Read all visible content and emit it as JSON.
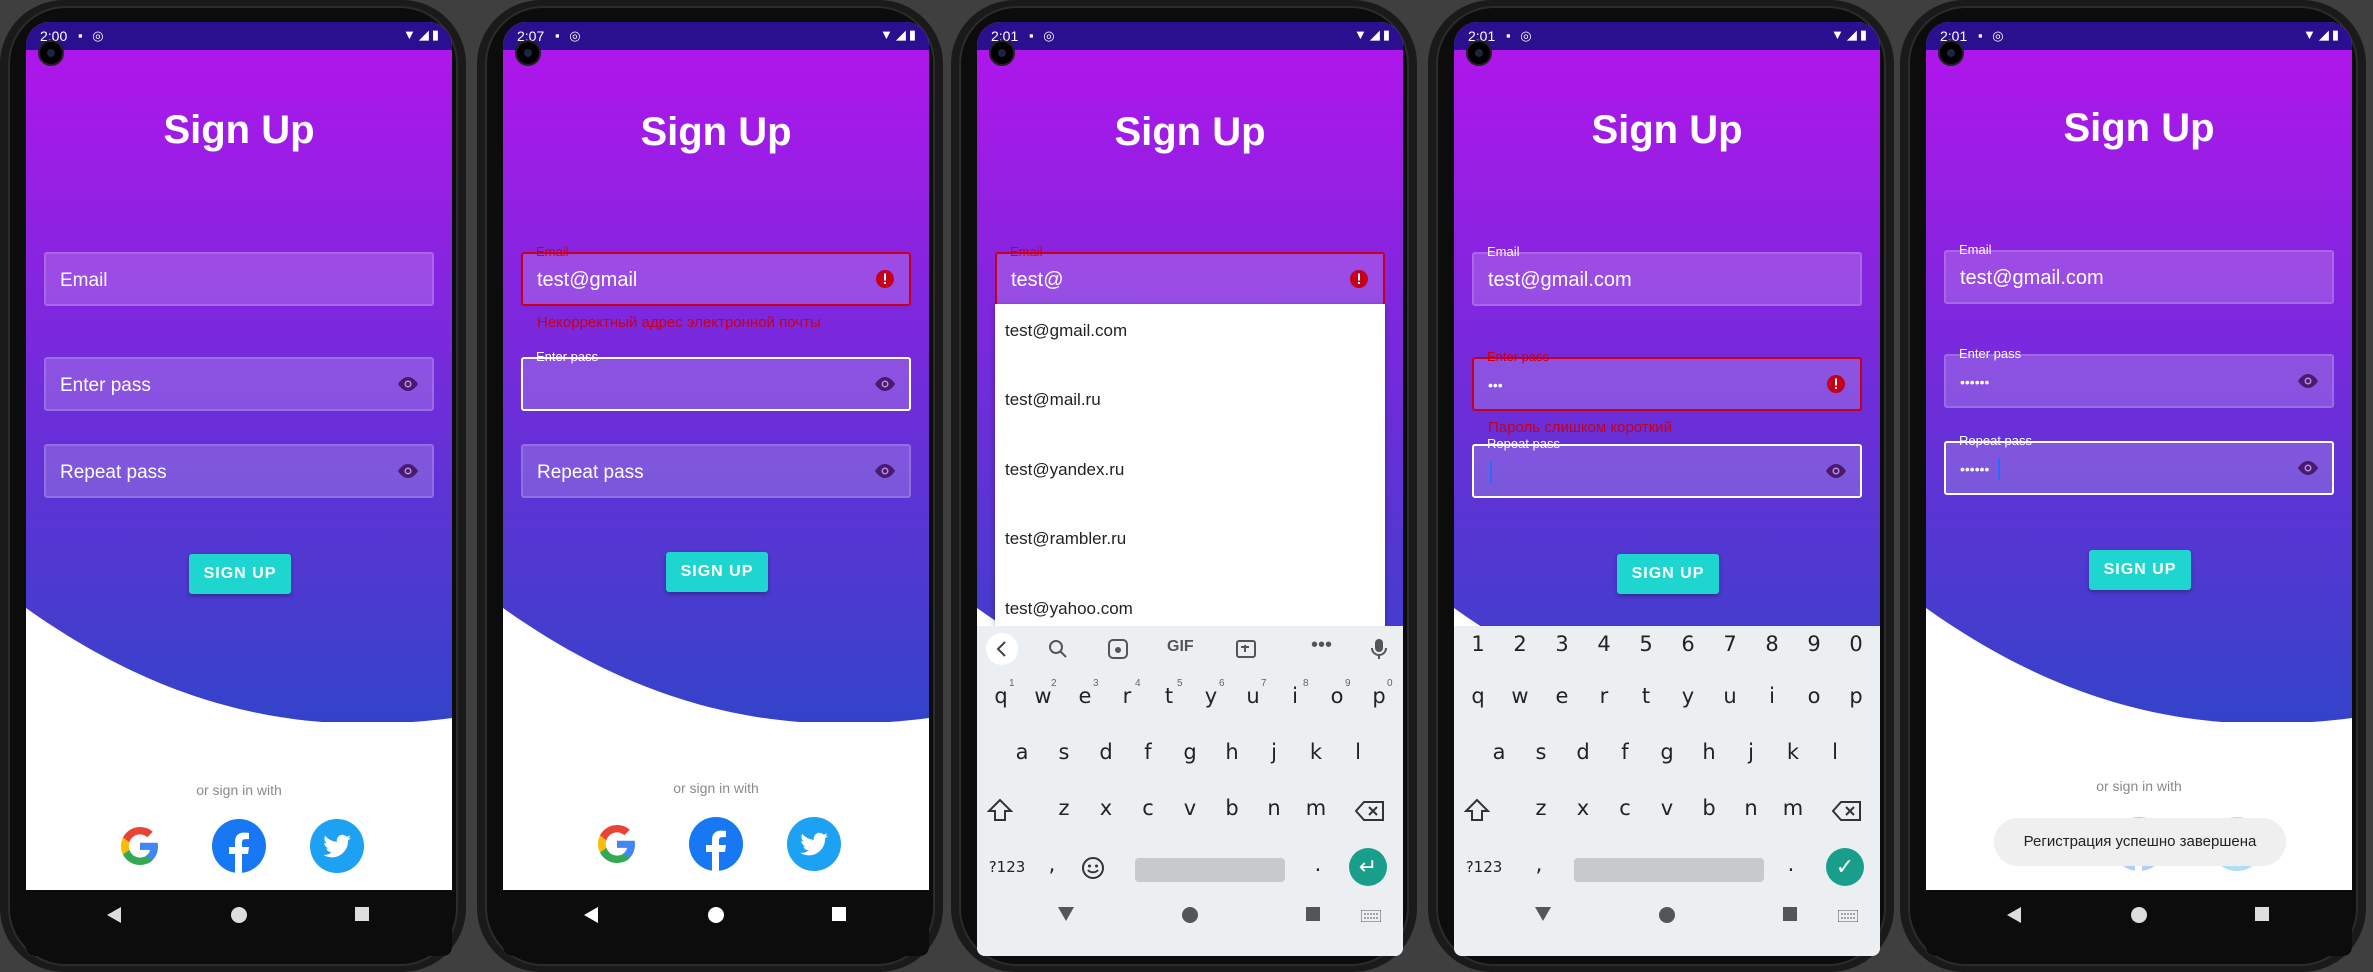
{
  "colors": {
    "gradient_top": "#b414ec",
    "gradient_bottom": "#3343c9",
    "accent": "#1ed6cf",
    "error": "#c4001a"
  },
  "screens": [
    {
      "status_time": "2:00",
      "title": "Sign Up",
      "email_placeholder": "Email",
      "pass_placeholder": "Enter pass",
      "repeat_placeholder": "Repeat pass",
      "button": "SIGN UP",
      "or_text": "or sign in with"
    },
    {
      "status_time": "2:07",
      "title": "Sign Up",
      "email_label": "Email",
      "email_value": "test@gmail",
      "email_error": "Некорректный адрес электронной почты",
      "pass_label": "Enter pass",
      "repeat_placeholder": "Repeat pass",
      "button": "SIGN UP",
      "or_text": "or sign in with"
    },
    {
      "status_time": "2:01",
      "title": "Sign Up",
      "email_label": "Email",
      "email_value": "test@",
      "suggestions": [
        "test@gmail.com",
        "test@mail.ru",
        "test@yandex.ru",
        "test@rambler.ru",
        "test@yahoo.com"
      ],
      "keyboard": {
        "tools": [
          "GIF"
        ],
        "row1": [
          "q",
          "w",
          "e",
          "r",
          "t",
          "y",
          "u",
          "i",
          "o",
          "p"
        ],
        "row1_sup": [
          "1",
          "2",
          "3",
          "4",
          "5",
          "6",
          "7",
          "8",
          "9",
          "0"
        ],
        "row2": [
          "a",
          "s",
          "d",
          "f",
          "g",
          "h",
          "j",
          "k",
          "l"
        ],
        "row3": [
          "z",
          "x",
          "c",
          "v",
          "b",
          "n",
          "m"
        ],
        "symbols": "?123",
        "comma": ",",
        "period": "."
      }
    },
    {
      "status_time": "2:01",
      "title": "Sign Up",
      "email_label": "Email",
      "email_value": "test@gmail.com",
      "pass_label": "Enter pass",
      "pass_value": "•••",
      "pass_error": "Пароль слишком короткий",
      "repeat_label": "Repeat pass",
      "button": "SIGN UP",
      "keyboard": {
        "numbers": [
          "1",
          "2",
          "3",
          "4",
          "5",
          "6",
          "7",
          "8",
          "9",
          "0"
        ],
        "row1": [
          "q",
          "w",
          "e",
          "r",
          "t",
          "y",
          "u",
          "i",
          "o",
          "p"
        ],
        "row2": [
          "a",
          "s",
          "d",
          "f",
          "g",
          "h",
          "j",
          "k",
          "l"
        ],
        "row3": [
          "z",
          "x",
          "c",
          "v",
          "b",
          "n",
          "m"
        ],
        "symbols": "?123",
        "comma": ",",
        "period": "."
      }
    },
    {
      "status_time": "2:01",
      "title": "Sign Up",
      "email_label": "Email",
      "email_value": "test@gmail.com",
      "pass_label": "Enter pass",
      "pass_value": "••••••",
      "repeat_label": "Repeat pass",
      "repeat_value": "••••••",
      "button": "SIGN UP",
      "or_text": "or sign in with",
      "toast": "Регистрация успешно завершена"
    }
  ]
}
